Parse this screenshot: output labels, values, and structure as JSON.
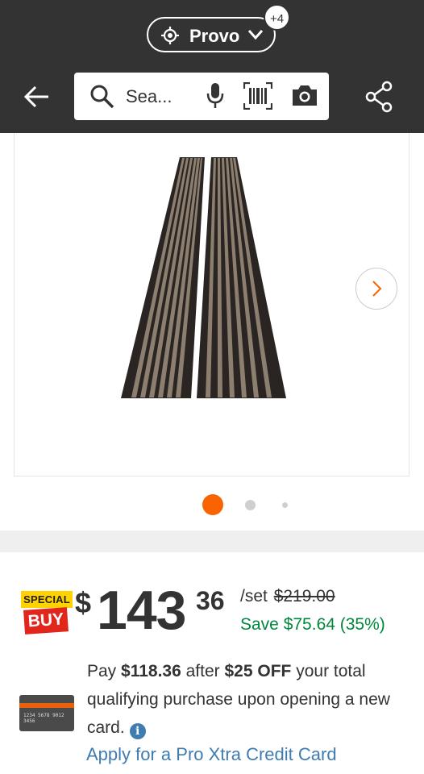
{
  "header": {
    "location": "Provo",
    "store_count_badge": "+4",
    "search_placeholder": "Sea..."
  },
  "gallery": {
    "dot_count": 3,
    "active_index": 0
  },
  "pricing": {
    "special_buy_top": "SPECIAL",
    "special_buy_bottom": "BUY",
    "currency_symbol": "$",
    "price_whole": "143",
    "price_cents": "36",
    "unit": "/set",
    "original_price": "$219.00",
    "savings": "Save $75.64 (35%)"
  },
  "credit_offer": {
    "text_pay": "Pay ",
    "amount_after": "$118.36",
    "text_after": " after ",
    "discount": "$25 OFF",
    "text_rest": " your total qualifying purchase upon opening a new card.",
    "apply_link": "Apply for a Pro Xtra Credit Card",
    "card_number": "1234 5678 9012 3456"
  },
  "colors": {
    "header_bg": "#333333",
    "accent_orange": "#f96302",
    "savings_green": "#00873c",
    "link_blue": "#3e7cb1",
    "special_yellow": "#ffd200",
    "special_red": "#e1261c"
  },
  "icons": [
    "location-target-icon",
    "chevron-down-icon",
    "back-arrow-icon",
    "search-icon",
    "microphone-icon",
    "barcode-icon",
    "camera-icon",
    "share-icon",
    "chevron-right-icon",
    "info-icon"
  ]
}
